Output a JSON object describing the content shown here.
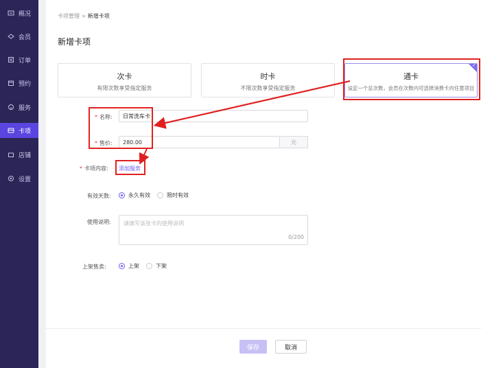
{
  "sidebar": {
    "items": [
      {
        "label": "概况",
        "icon": "overview-icon"
      },
      {
        "label": "会员",
        "icon": "member-icon"
      },
      {
        "label": "订单",
        "icon": "order-icon"
      },
      {
        "label": "预约",
        "icon": "appointment-icon"
      },
      {
        "label": "服务",
        "icon": "service-icon"
      },
      {
        "label": "卡项",
        "icon": "card-icon"
      },
      {
        "label": "店铺",
        "icon": "store-icon"
      },
      {
        "label": "设置",
        "icon": "settings-icon"
      }
    ],
    "active_index": 5
  },
  "breadcrumb": {
    "parent": "卡项管理",
    "sep": ">",
    "current": "新增卡项"
  },
  "page_title": "新增卡项",
  "card_types": [
    {
      "title": "次卡",
      "desc": "有限次数享受指定服务"
    },
    {
      "title": "时卡",
      "desc": "不限次数享受指定服务"
    },
    {
      "title": "通卡",
      "desc": "设定一个总次数，会员在次数内可选择消费卡内任意项目",
      "selected": true
    }
  ],
  "form": {
    "name_label": "名称:",
    "name_value": "日常洗车卡",
    "price_label": "售价:",
    "price_value": "280.00",
    "price_unit": "元",
    "content_label": "卡项内容:",
    "add_service_link": "添加服务",
    "validity_label": "有效天数:",
    "validity_options": [
      "永久有效",
      "限时有效"
    ],
    "validity_selected": 0,
    "usage_label": "使用说明:",
    "usage_placeholder": "请填写该张卡的使用说明",
    "usage_counter": "0/200",
    "listing_label": "上架售卖:",
    "listing_options": [
      "上架",
      "下架"
    ],
    "listing_selected": 0
  },
  "footer": {
    "save_label": "保存",
    "cancel_label": "取消"
  },
  "colors": {
    "sidebar_bg": "#2b2657",
    "accent": "#6b5cf0",
    "active_nav": "#5a45e0",
    "annotation_red": "#e02020"
  }
}
